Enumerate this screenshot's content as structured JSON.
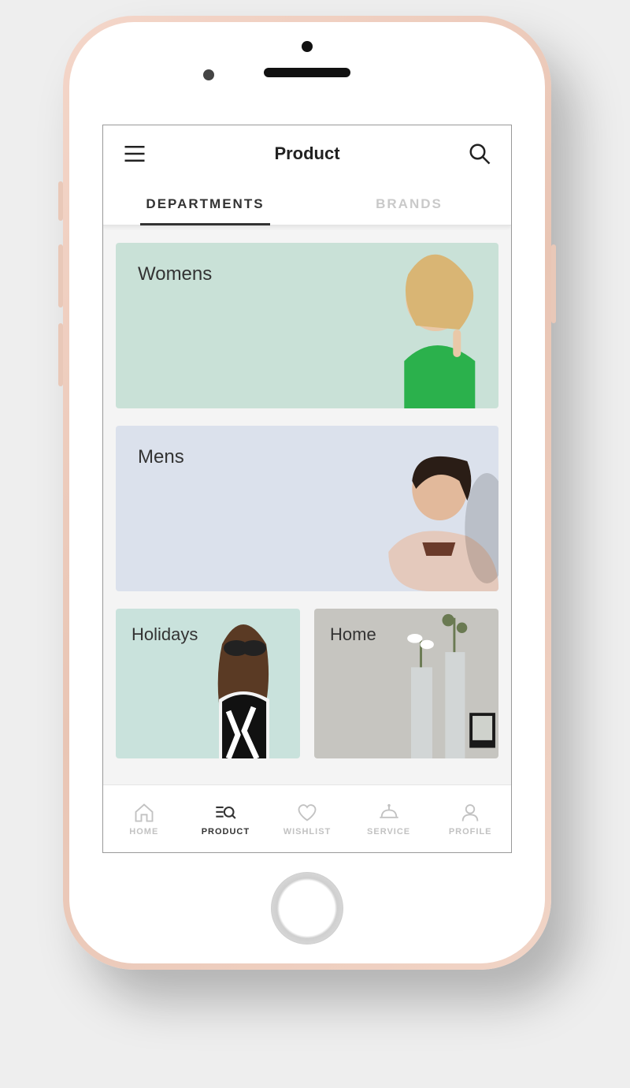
{
  "header": {
    "title": "Product"
  },
  "tabs": {
    "departments": "DEPARTMENTS",
    "brands": "BRANDS",
    "active": "departments"
  },
  "categories": {
    "womens": "Womens",
    "mens": "Mens",
    "holidays": "Holidays",
    "home": "Home"
  },
  "bottomnav": {
    "home": "HOME",
    "product": "PRODUCT",
    "wishlist": "WISHLIST",
    "service": "SERVICE",
    "profile": "PROFILE",
    "active": "product"
  },
  "colors": {
    "womens": "#c9e1d7",
    "mens": "#dbe1ec",
    "holidays": "#c9e2dc",
    "home": "#c6c5c0"
  }
}
